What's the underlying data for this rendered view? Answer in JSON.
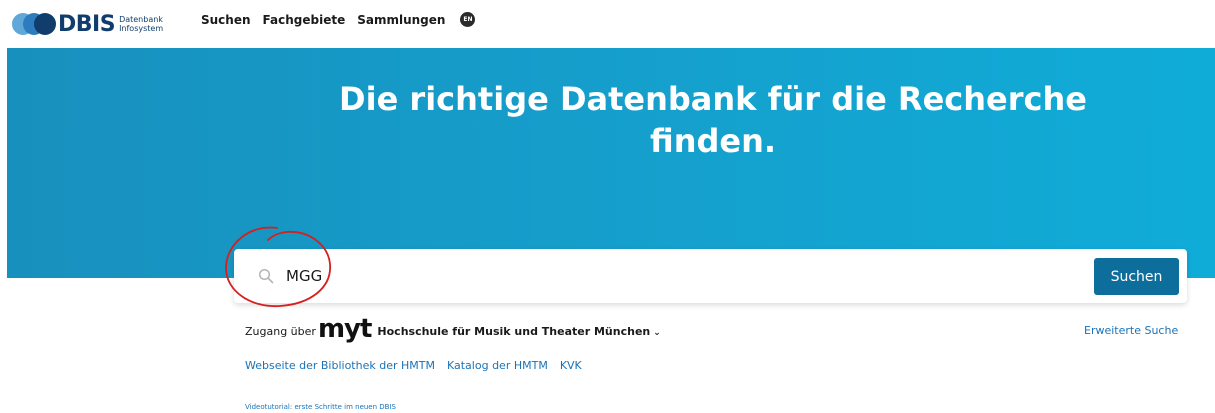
{
  "brand": {
    "name": "DBIS",
    "sub_line1": "Datenbank",
    "sub_line2": "Infosystem",
    "colors": [
      "#5fa8d8",
      "#2d7cc0",
      "#103d6b"
    ]
  },
  "nav": {
    "items": [
      "Suchen",
      "Fachgebiete",
      "Sammlungen"
    ],
    "language": "EN"
  },
  "hero": {
    "title_line1": "Die richtige Datenbank für die Recherche",
    "title_line2": "finden.",
    "background": "#1598c6"
  },
  "search": {
    "value": "MGG",
    "placeholder": "",
    "icon": "search-icon",
    "button_label": "Suchen",
    "button_color": "#0d6e9c"
  },
  "annotation": {
    "shape": "hand-drawn circle",
    "color": "#d61f1f"
  },
  "access": {
    "prefix": "Zugang über",
    "logo_text": "myt",
    "institution": "Hochschule für Musik und Theater München",
    "advanced_search": "Erweiterte Suche"
  },
  "links": [
    "Webseite der Bibliothek der HMTM",
    "Katalog der HMTM",
    "KVK"
  ],
  "tutorial": "Videotutorial: erste Schritte im neuen DBIS"
}
